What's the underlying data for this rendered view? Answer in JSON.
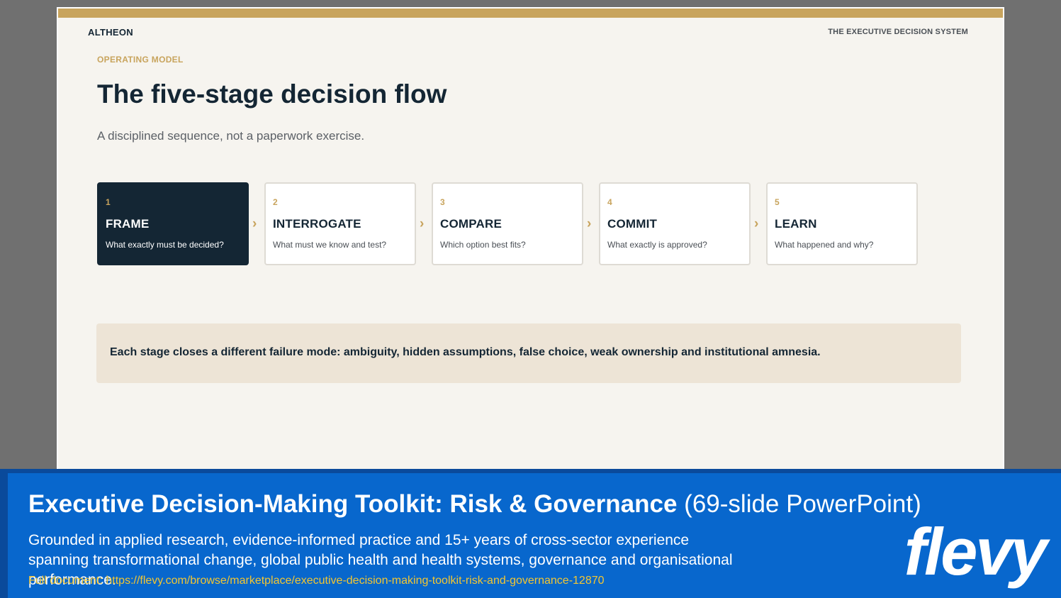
{
  "slide": {
    "brand": "ALTHEON",
    "system_label": "THE EXECUTIVE DECISION SYSTEM",
    "eyebrow": "OPERATING MODEL",
    "title": "The five-stage decision flow",
    "subtitle": "A disciplined sequence, not a paperwork exercise.",
    "chevron": "›",
    "stages": [
      {
        "number": "1",
        "name": "FRAME",
        "question": "What exactly must be decided?"
      },
      {
        "number": "2",
        "name": "INTERROGATE",
        "question": "What must we know and test?"
      },
      {
        "number": "3",
        "name": "COMPARE",
        "question": "Which option best fits?"
      },
      {
        "number": "4",
        "name": "COMMIT",
        "question": "What exactly is approved?"
      },
      {
        "number": "5",
        "name": "LEARN",
        "question": "What happened and why?"
      }
    ],
    "callout": "Each stage closes a different failure mode: ambiguity, hidden assumptions, false choice, weak ownership and institutional amnesia."
  },
  "footer": {
    "title_bold": "Executive Decision-Making Toolkit: Risk & Governance",
    "title_light": "(69-slide PowerPoint)",
    "description": "Grounded in applied research, evidence-informed practice and 15+ years of cross-sector experience spanning transformational change, global public health and health systems, governance and organisational performance.",
    "link": "Full document: https://flevy.com/browse/marketplace/executive-decision-making-toolkit-risk-and-governance-12870",
    "logo": "flevy"
  },
  "colors": {
    "gold": "#c8a45d",
    "navy": "#142634",
    "slide_bg": "#f6f4ef",
    "callout_bg": "#ede4d6",
    "footer_blue": "#0867cd",
    "link_yellow": "#f3c631"
  }
}
